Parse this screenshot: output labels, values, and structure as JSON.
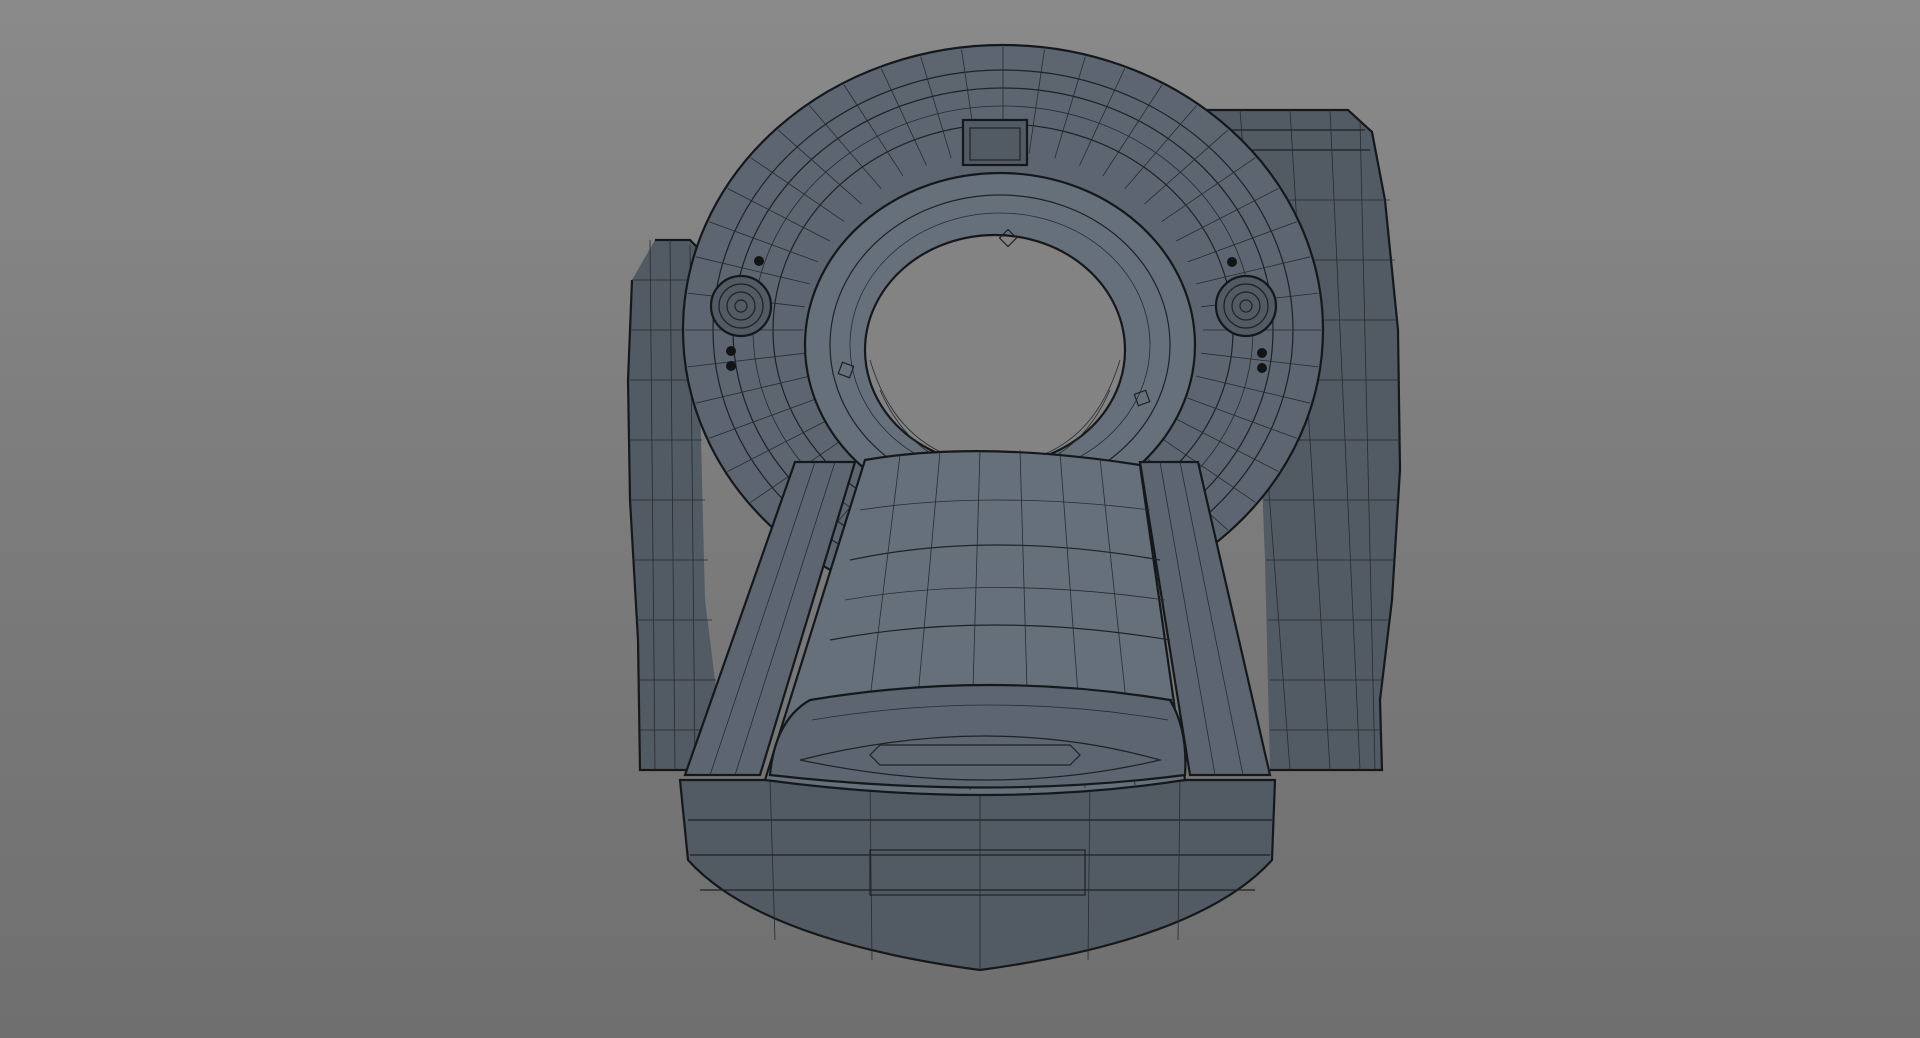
{
  "viewport": {
    "background_top": "#8a8a8a",
    "background_bottom": "#6f6f6f"
  },
  "model": {
    "subject": "ct-scanner-wireframe",
    "mesh_color": "#5c6570",
    "wire_color": "#1e2226"
  }
}
